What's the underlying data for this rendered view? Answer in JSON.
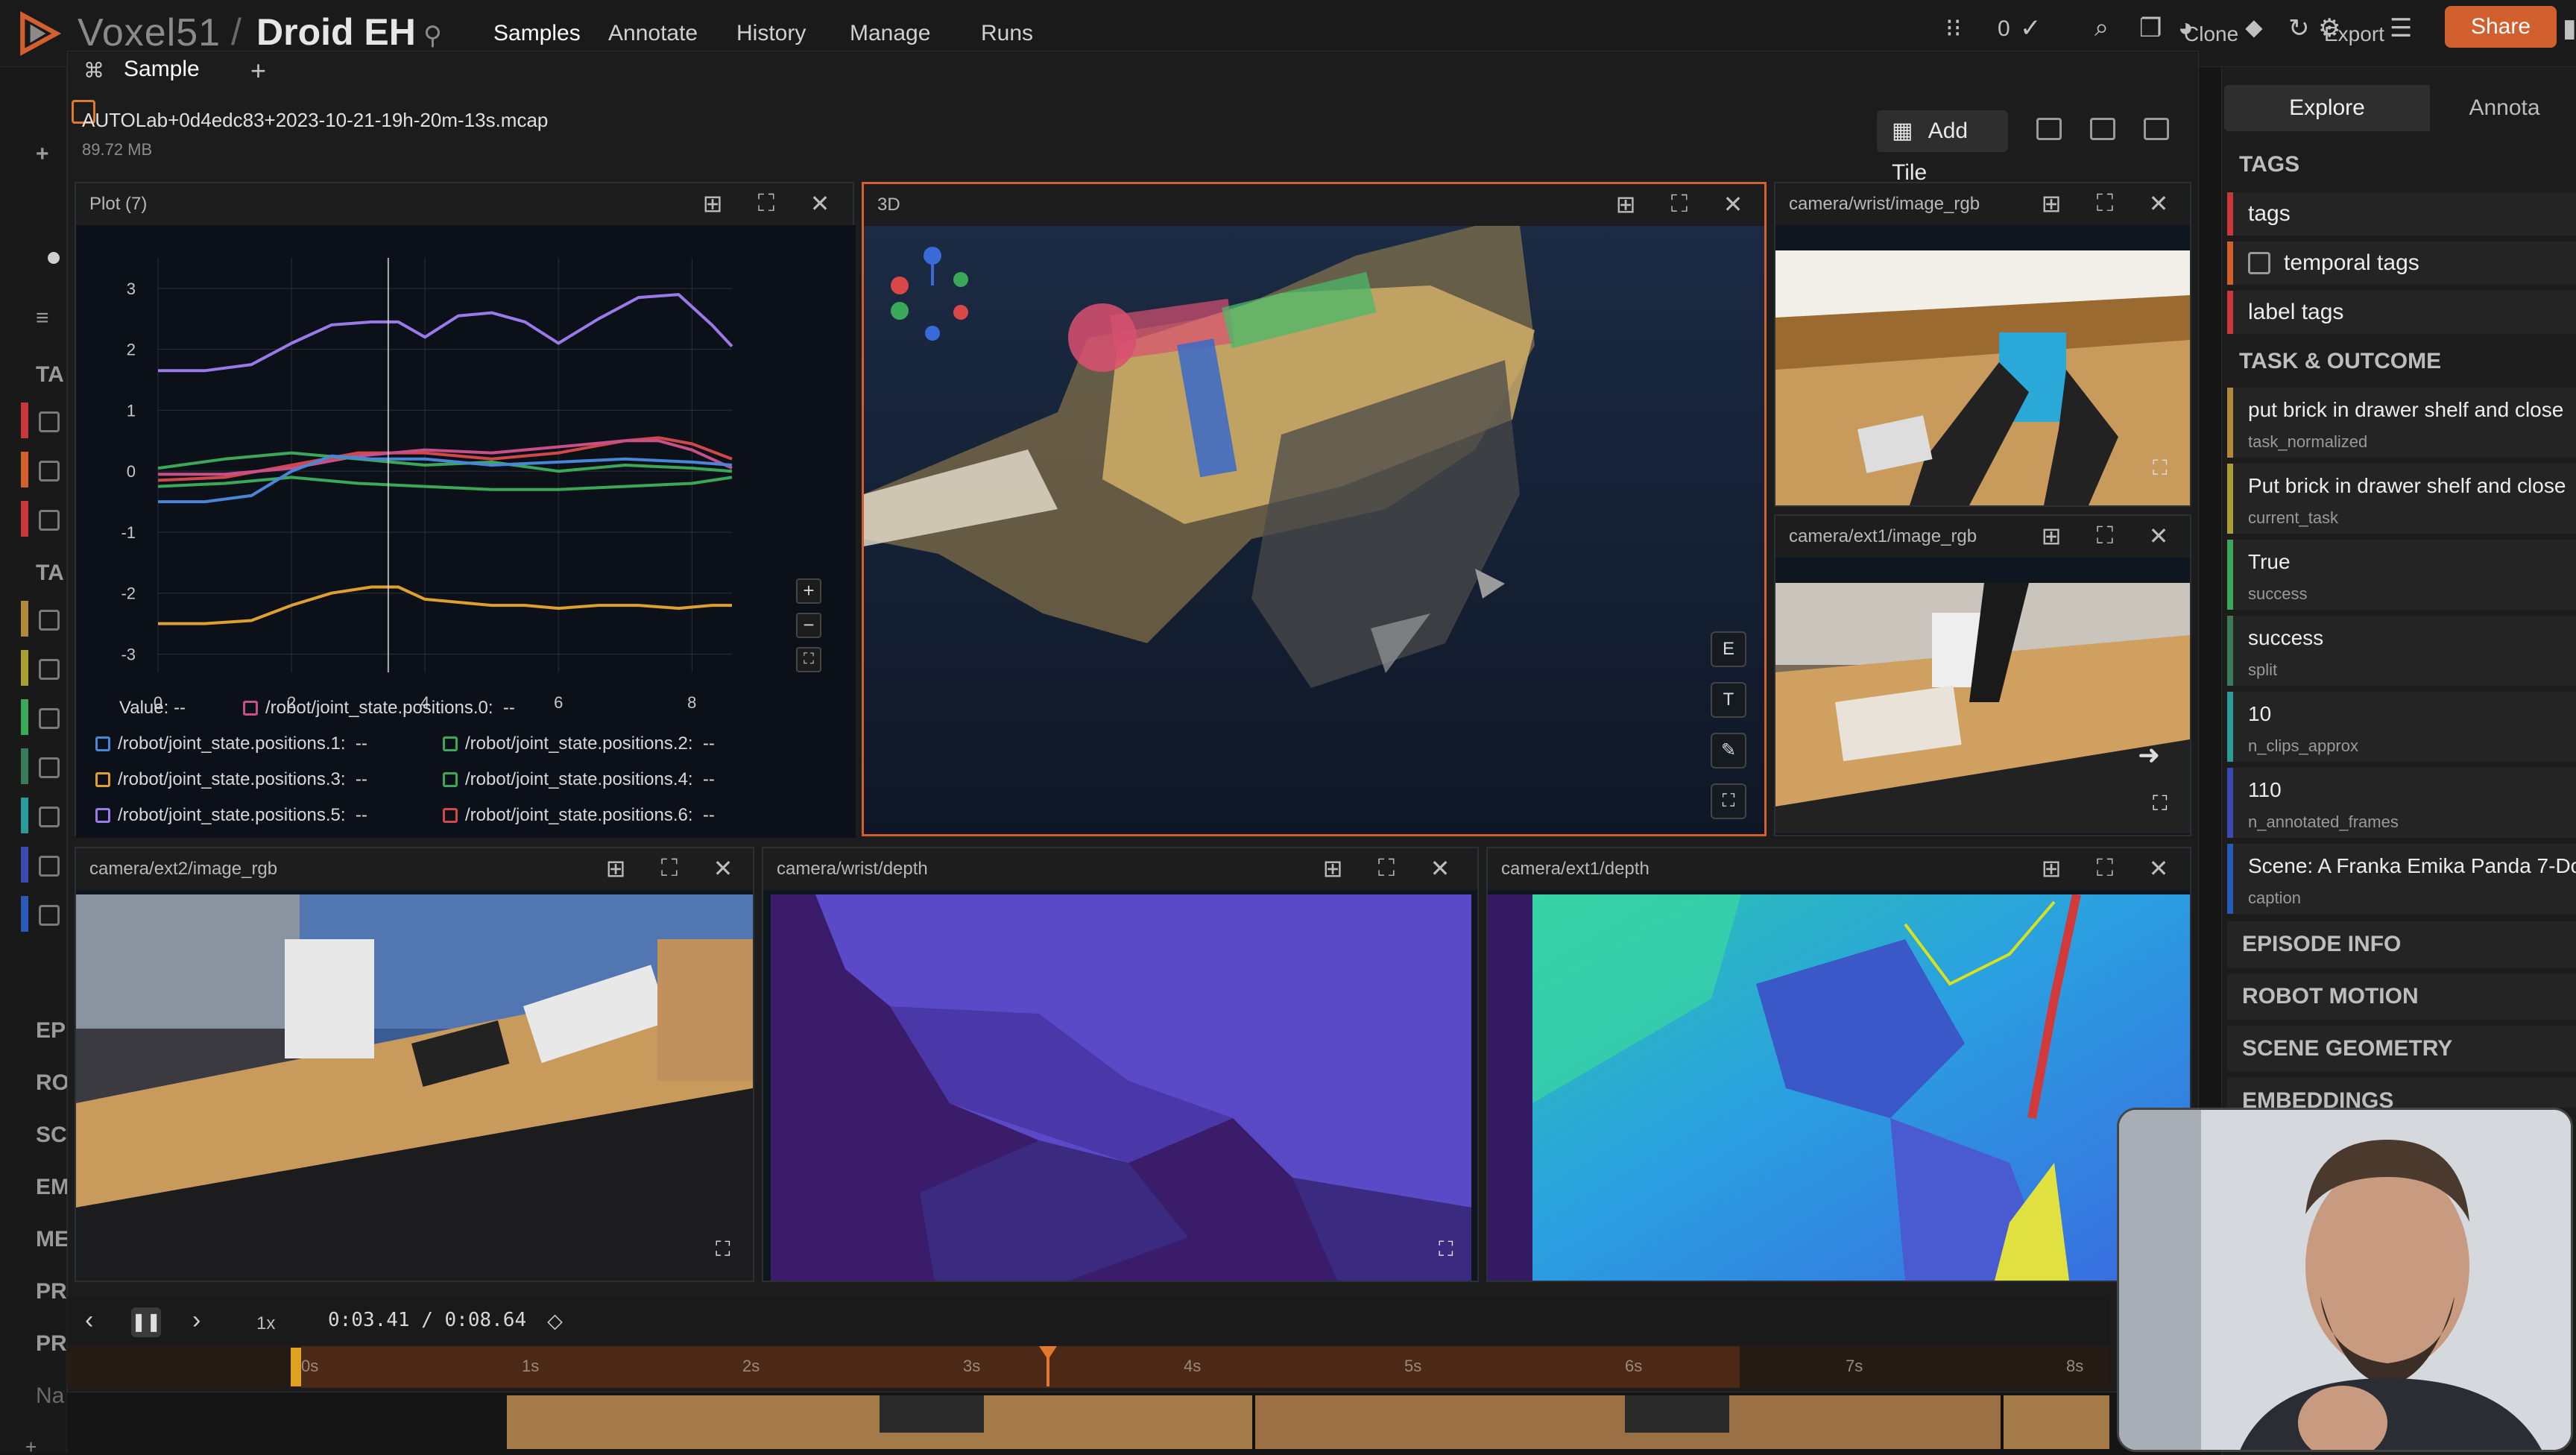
{
  "app": {
    "brand": "Voxel51",
    "dataset": "Droid EH",
    "nav": [
      "Samples",
      "Annotate",
      "History",
      "Manage",
      "Runs"
    ],
    "selected_count": "0",
    "toolbar_clone": "Clone",
    "toolbar_export": "Export",
    "share": "Share"
  },
  "left_sidebar": {
    "sections": [
      "TA",
      "TA",
      "EP",
      "RO",
      "SC",
      "EM",
      "ME",
      "PR",
      "PR",
      "Na"
    ],
    "add": "+ AD"
  },
  "modal": {
    "tab": "Sample",
    "plus": "+",
    "file_name": "AUTOLab+0d4edc83+2023-10-21-19h-20m-13s.mcap",
    "file_size": "89.72 MB",
    "add_tile": "Add Tile"
  },
  "panels": {
    "plot": {
      "title": "Plot (7)"
    },
    "three_d": {
      "title": "3D",
      "buttons": [
        "E",
        "T"
      ]
    },
    "wrist_rgb": {
      "title": "camera/wrist/image_rgb"
    },
    "ext1_rgb": {
      "title": "camera/ext1/image_rgb"
    },
    "ext2_rgb": {
      "title": "camera/ext2/image_rgb"
    },
    "wrist_depth": {
      "title": "camera/wrist/depth"
    },
    "ext1_depth": {
      "title": "camera/ext1/depth"
    }
  },
  "chart_data": {
    "type": "line",
    "xlim": [
      0,
      8.6
    ],
    "ylim": [
      -3.3,
      3.5
    ],
    "xticks": [
      0,
      2,
      4,
      6,
      8
    ],
    "yticks": [
      3,
      2,
      1,
      0,
      -1,
      -2,
      -3
    ],
    "cursor_x": 3.45,
    "grid": true,
    "value_label": "Value:",
    "value_readout": "--",
    "legend": [
      {
        "name": "/robot/joint_state.positions.0:",
        "value": "--",
        "color": "#c8508a"
      },
      {
        "name": "/robot/joint_state.positions.1:",
        "value": "--",
        "color": "#4a86d8"
      },
      {
        "name": "/robot/joint_state.positions.2:",
        "value": "--",
        "color": "#3aa858"
      },
      {
        "name": "/robot/joint_state.positions.3:",
        "value": "--",
        "color": "#e0a030"
      },
      {
        "name": "/robot/joint_state.positions.4:",
        "value": "--",
        "color": "#3aa858"
      },
      {
        "name": "/robot/joint_state.positions.5:",
        "value": "--",
        "color": "#9a7ae8"
      },
      {
        "name": "/robot/joint_state.positions.6:",
        "value": "--",
        "color": "#d04848"
      }
    ],
    "series": [
      {
        "color": "#9a7ae8",
        "x": [
          0,
          0.7,
          1.4,
          2,
          2.6,
          3.2,
          3.6,
          4,
          4.5,
          5,
          5.5,
          6,
          6.6,
          7.2,
          7.8,
          8.3,
          8.6
        ],
        "y": [
          1.65,
          1.65,
          1.75,
          2.1,
          2.4,
          2.45,
          2.45,
          2.2,
          2.55,
          2.6,
          2.45,
          2.1,
          2.5,
          2.85,
          2.9,
          2.4,
          2.05
        ]
      },
      {
        "color": "#e0a030",
        "x": [
          0,
          0.7,
          1.4,
          2,
          2.6,
          3.2,
          3.6,
          4,
          4.5,
          5,
          5.5,
          6,
          6.6,
          7.2,
          7.8,
          8.3,
          8.6
        ],
        "y": [
          -2.5,
          -2.5,
          -2.45,
          -2.2,
          -2.0,
          -1.9,
          -1.9,
          -2.1,
          -2.15,
          -2.2,
          -2.2,
          -2.25,
          -2.2,
          -2.2,
          -2.25,
          -2.2,
          -2.2
        ]
      },
      {
        "color": "#d04848",
        "x": [
          0,
          1,
          2,
          3,
          4,
          5,
          6,
          7,
          7.5,
          8,
          8.6
        ],
        "y": [
          -0.15,
          -0.1,
          0.1,
          0.3,
          0.3,
          0.2,
          0.3,
          0.5,
          0.55,
          0.45,
          0.2
        ]
      },
      {
        "color": "#c8508a",
        "x": [
          0,
          1,
          2,
          3,
          4,
          5,
          6,
          7,
          7.5,
          8,
          8.6
        ],
        "y": [
          -0.05,
          -0.05,
          0.05,
          0.25,
          0.35,
          0.3,
          0.4,
          0.5,
          0.5,
          0.35,
          0.05
        ]
      },
      {
        "color": "#3aa858",
        "x": [
          0,
          1,
          2,
          3,
          4,
          5,
          6,
          7,
          8,
          8.6
        ],
        "y": [
          0.05,
          0.2,
          0.3,
          0.2,
          0.1,
          0.15,
          0.0,
          0.1,
          0.05,
          0.0
        ]
      },
      {
        "color": "#3aa858",
        "x": [
          0,
          1,
          2,
          3,
          4,
          5,
          6,
          7,
          8,
          8.6
        ],
        "y": [
          -0.25,
          -0.2,
          -0.1,
          -0.2,
          -0.25,
          -0.3,
          -0.3,
          -0.25,
          -0.2,
          -0.1
        ]
      },
      {
        "color": "#4a86d8",
        "x": [
          0,
          0.7,
          1.4,
          2,
          2.6,
          3.2,
          4,
          5,
          6,
          7,
          8,
          8.6
        ],
        "y": [
          -0.5,
          -0.5,
          -0.4,
          0.0,
          0.25,
          0.2,
          0.2,
          0.1,
          0.15,
          0.2,
          0.15,
          0.1
        ]
      }
    ]
  },
  "controls": {
    "speed": "1x",
    "time": "0:03.41 / 0:08.64"
  },
  "timeline": {
    "labels": [
      "0s",
      "1s",
      "2s",
      "3s",
      "4s",
      "5s",
      "6s",
      "7s",
      "8s"
    ]
  },
  "right_sidebar": {
    "tabs": [
      "Explore",
      "Annota"
    ],
    "tags_header": "TAGS",
    "tags": [
      "tags",
      "temporal tags",
      "label tags"
    ],
    "task_header": "TASK & OUTCOME",
    "fields": [
      {
        "value": "put brick in drawer shelf and close",
        "key": "task_normalized",
        "color": "#b08a3a"
      },
      {
        "value": "Put brick in drawer shelf and close",
        "key": "current_task",
        "color": "#a8a030"
      },
      {
        "value": "True",
        "key": "success",
        "color": "#3aa858"
      },
      {
        "value": "success",
        "key": "split",
        "color": "#3a7a5a"
      },
      {
        "value": "10",
        "key": "n_clips_approx",
        "color": "#2a9a9a"
      },
      {
        "value": "110",
        "key": "n_annotated_frames",
        "color": "#3a4ab0"
      },
      {
        "value": "Scene: A Franka Emika Panda 7-Do",
        "key": "caption",
        "color": "#2a5ab8"
      }
    ],
    "sections": [
      "EPISODE INFO",
      "ROBOT MOTION",
      "SCENE GEOMETRY",
      "EMBEDDINGS"
    ]
  }
}
